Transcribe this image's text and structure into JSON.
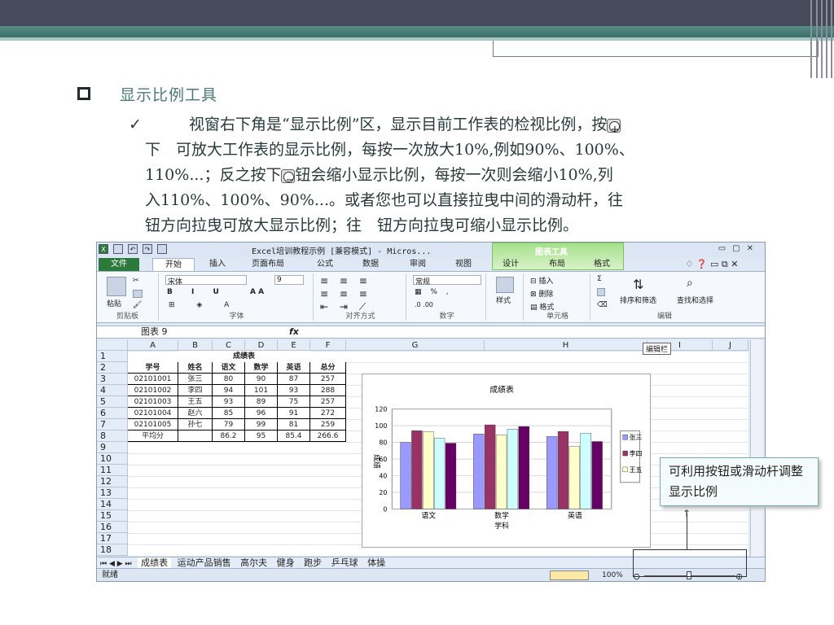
{
  "slide": {
    "title": "显示比例工具",
    "paragraph_lines": [
      "视窗右下角是“显示比例”区，显示目前工作表的检视比例，按",
      "下　可放大工作表的显示比例，每按一次放大10%,例如90%、100%、",
      "110%...；反之按下",
      "钮会缩小显示比例，每按一次则会缩小10%,列",
      "入110%、100%、90%...。或者您也可以直接拉曳中间的滑动杆，往",
      "钮方向拉曳可放大显示比例；往　钮方向拉曳可缩小显示比例。"
    ],
    "note": "可利用按钮或滑动杆调整显示比例"
  },
  "excel": {
    "title": "Excel培训教程示例 [兼容模式] - Micros...",
    "chart_tools": "图表工具",
    "tabs": [
      "文件",
      "开始",
      "插入",
      "页面布局",
      "公式",
      "数据",
      "审阅",
      "视图",
      "设计",
      "布局",
      "格式"
    ],
    "ribbon": {
      "paste": "粘贴",
      "clipboard": "剪贴板",
      "font_name": "宋体",
      "font_size": "9",
      "font": "字体",
      "alignment": "对齐方式",
      "number_format": "常规",
      "number": "数字",
      "styles": "样式",
      "insert": "插入",
      "delete": "删除",
      "format": "格式",
      "cells": "单元格",
      "sort_filter": "排序和筛选",
      "find_select": "查找和选择",
      "editing": "编辑"
    },
    "name_box": "图表 9",
    "fx": "fx",
    "edit_bar_label": "编辑栏",
    "columns": [
      "A",
      "B",
      "C",
      "D",
      "E",
      "F",
      "G",
      "H",
      "I",
      "J"
    ],
    "rows": [
      "1",
      "2",
      "3",
      "4",
      "5",
      "6",
      "7",
      "8",
      "9",
      "10",
      "11",
      "12",
      "13",
      "14",
      "15",
      "16",
      "17",
      "18"
    ],
    "table": {
      "title": "成绩表",
      "headers": [
        "学号",
        "姓名",
        "语文",
        "数学",
        "英语",
        "总分"
      ],
      "data": [
        [
          "02101001",
          "张三",
          "80",
          "90",
          "87",
          "257"
        ],
        [
          "02101002",
          "李四",
          "94",
          "101",
          "93",
          "288"
        ],
        [
          "02101003",
          "王五",
          "93",
          "89",
          "75",
          "257"
        ],
        [
          "02101004",
          "赵六",
          "85",
          "96",
          "91",
          "272"
        ],
        [
          "02101005",
          "孙七",
          "79",
          "99",
          "81",
          "259"
        ]
      ],
      "avg_label": "平均分",
      "avg": [
        "86.2",
        "95",
        "85.4",
        "266.6"
      ]
    },
    "sheet_tabs": [
      "成绩表",
      "运动产品销售",
      "高尔夫",
      "健身",
      "跑步",
      "乒乓球",
      "体操"
    ],
    "status": "就绪",
    "zoom": "100%"
  },
  "chart_data": {
    "type": "bar",
    "title": "成绩表",
    "categories": [
      "语文",
      "数学",
      "英语"
    ],
    "series": [
      {
        "name": "张三",
        "values": [
          80,
          90,
          87
        ]
      },
      {
        "name": "李四",
        "values": [
          94,
          101,
          93
        ]
      },
      {
        "name": "王五",
        "values": [
          93,
          89,
          75
        ]
      },
      {
        "name": "赵六",
        "values": [
          85,
          96,
          91
        ]
      },
      {
        "name": "孙七",
        "values": [
          79,
          99,
          81
        ]
      }
    ],
    "xlabel": "学科",
    "ylabel": "成绩",
    "yticks": [
      "0",
      "20",
      "40",
      "60",
      "80",
      "100",
      "120"
    ],
    "ylim": [
      0,
      120
    ],
    "legend_items": [
      "张三",
      "李四",
      "王五"
    ],
    "colors": [
      "#9999ff",
      "#993366",
      "#ffffcc",
      "#ccffff",
      "#660066"
    ]
  }
}
